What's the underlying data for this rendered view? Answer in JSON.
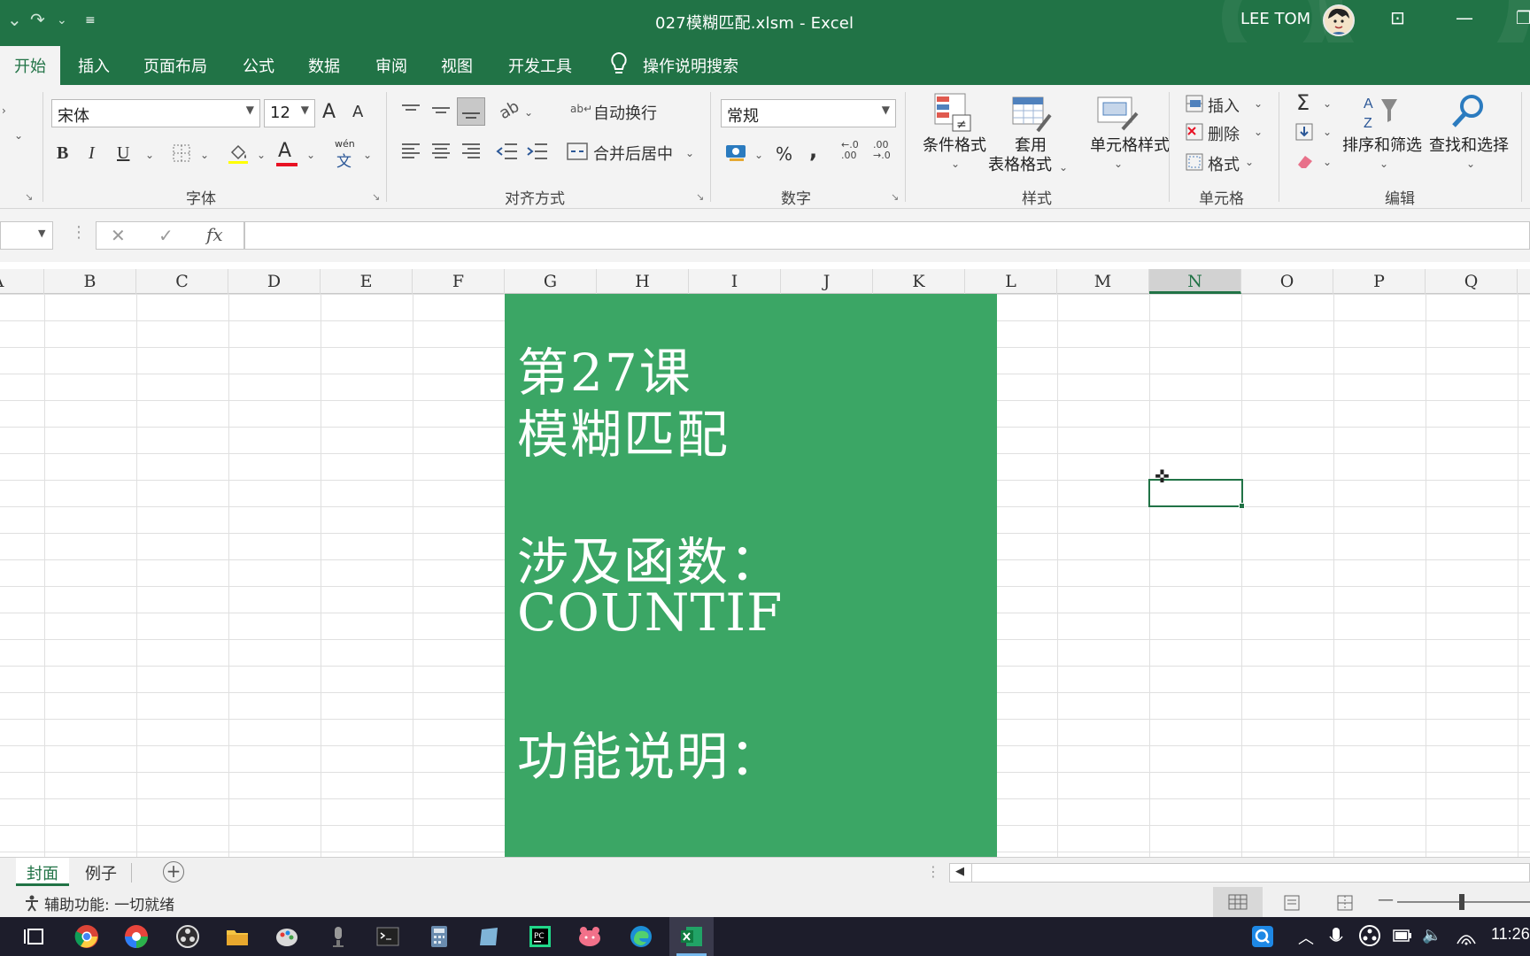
{
  "titlebar": {
    "document_title": "027模糊匹配.xlsm  -  Excel",
    "user_name": "LEE TOM",
    "icons": [
      "undo-icon",
      "redo-icon",
      "customize-qat-icon",
      "ribbon-display-icon",
      "minimize-icon",
      "restore-icon"
    ]
  },
  "ribbon_tabs": [
    "开始",
    "插入",
    "页面布局",
    "公式",
    "数据",
    "审阅",
    "视图",
    "开发工具"
  ],
  "tell_me": "操作说明搜索",
  "font_group": {
    "label": "字体",
    "font_name": "宋体",
    "font_size": "12",
    "bold": "B",
    "italic": "I",
    "underline": "U",
    "grow": "A",
    "shrink": "A",
    "color_A": "A",
    "phonetic_top": "wén",
    "phonetic_bottom": "文"
  },
  "alignment_group": {
    "label": "对齐方式",
    "wrap_text": "自动换行",
    "merge_center": "合并后居中"
  },
  "number_group": {
    "label": "数字",
    "format": "常规",
    "percent": "%",
    "comma": ",",
    "inc_decimal_top": "←.0",
    "inc_decimal_bottom": ".00",
    "dec_decimal_top": ".00",
    "dec_decimal_bottom": "→.0"
  },
  "styles_group": {
    "label": "样式",
    "conditional": "条件格式",
    "table_format_1": "套用",
    "table_format_2": "表格格式",
    "cell_styles": "单元格样式"
  },
  "cells_group": {
    "label": "单元格",
    "insert": "插入",
    "delete": "删除",
    "format": "格式"
  },
  "editing_group": {
    "label": "编辑",
    "sigma": "Σ",
    "sort_filter": "排序和筛选",
    "find_select": "查找和选择"
  },
  "formula_bar": {
    "cancel": "✕",
    "enter": "✓",
    "fx": "fx",
    "value": ""
  },
  "columns": [
    "A",
    "B",
    "C",
    "D",
    "E",
    "F",
    "G",
    "H",
    "I",
    "J",
    "K",
    "L",
    "M",
    "N",
    "O",
    "P",
    "Q"
  ],
  "selected_column": "N",
  "cover": {
    "line1": "第27课",
    "line2": "模糊匹配",
    "line3": "涉及函数：",
    "line4": "COUNTIF",
    "line5": "功能说明："
  },
  "sheets": [
    "封面",
    "例子"
  ],
  "active_sheet": "封面",
  "status": "辅助功能: 一切就绪",
  "clock": "11:26",
  "colors": {
    "excel_green": "#217346",
    "cover_green": "#3ba665"
  }
}
